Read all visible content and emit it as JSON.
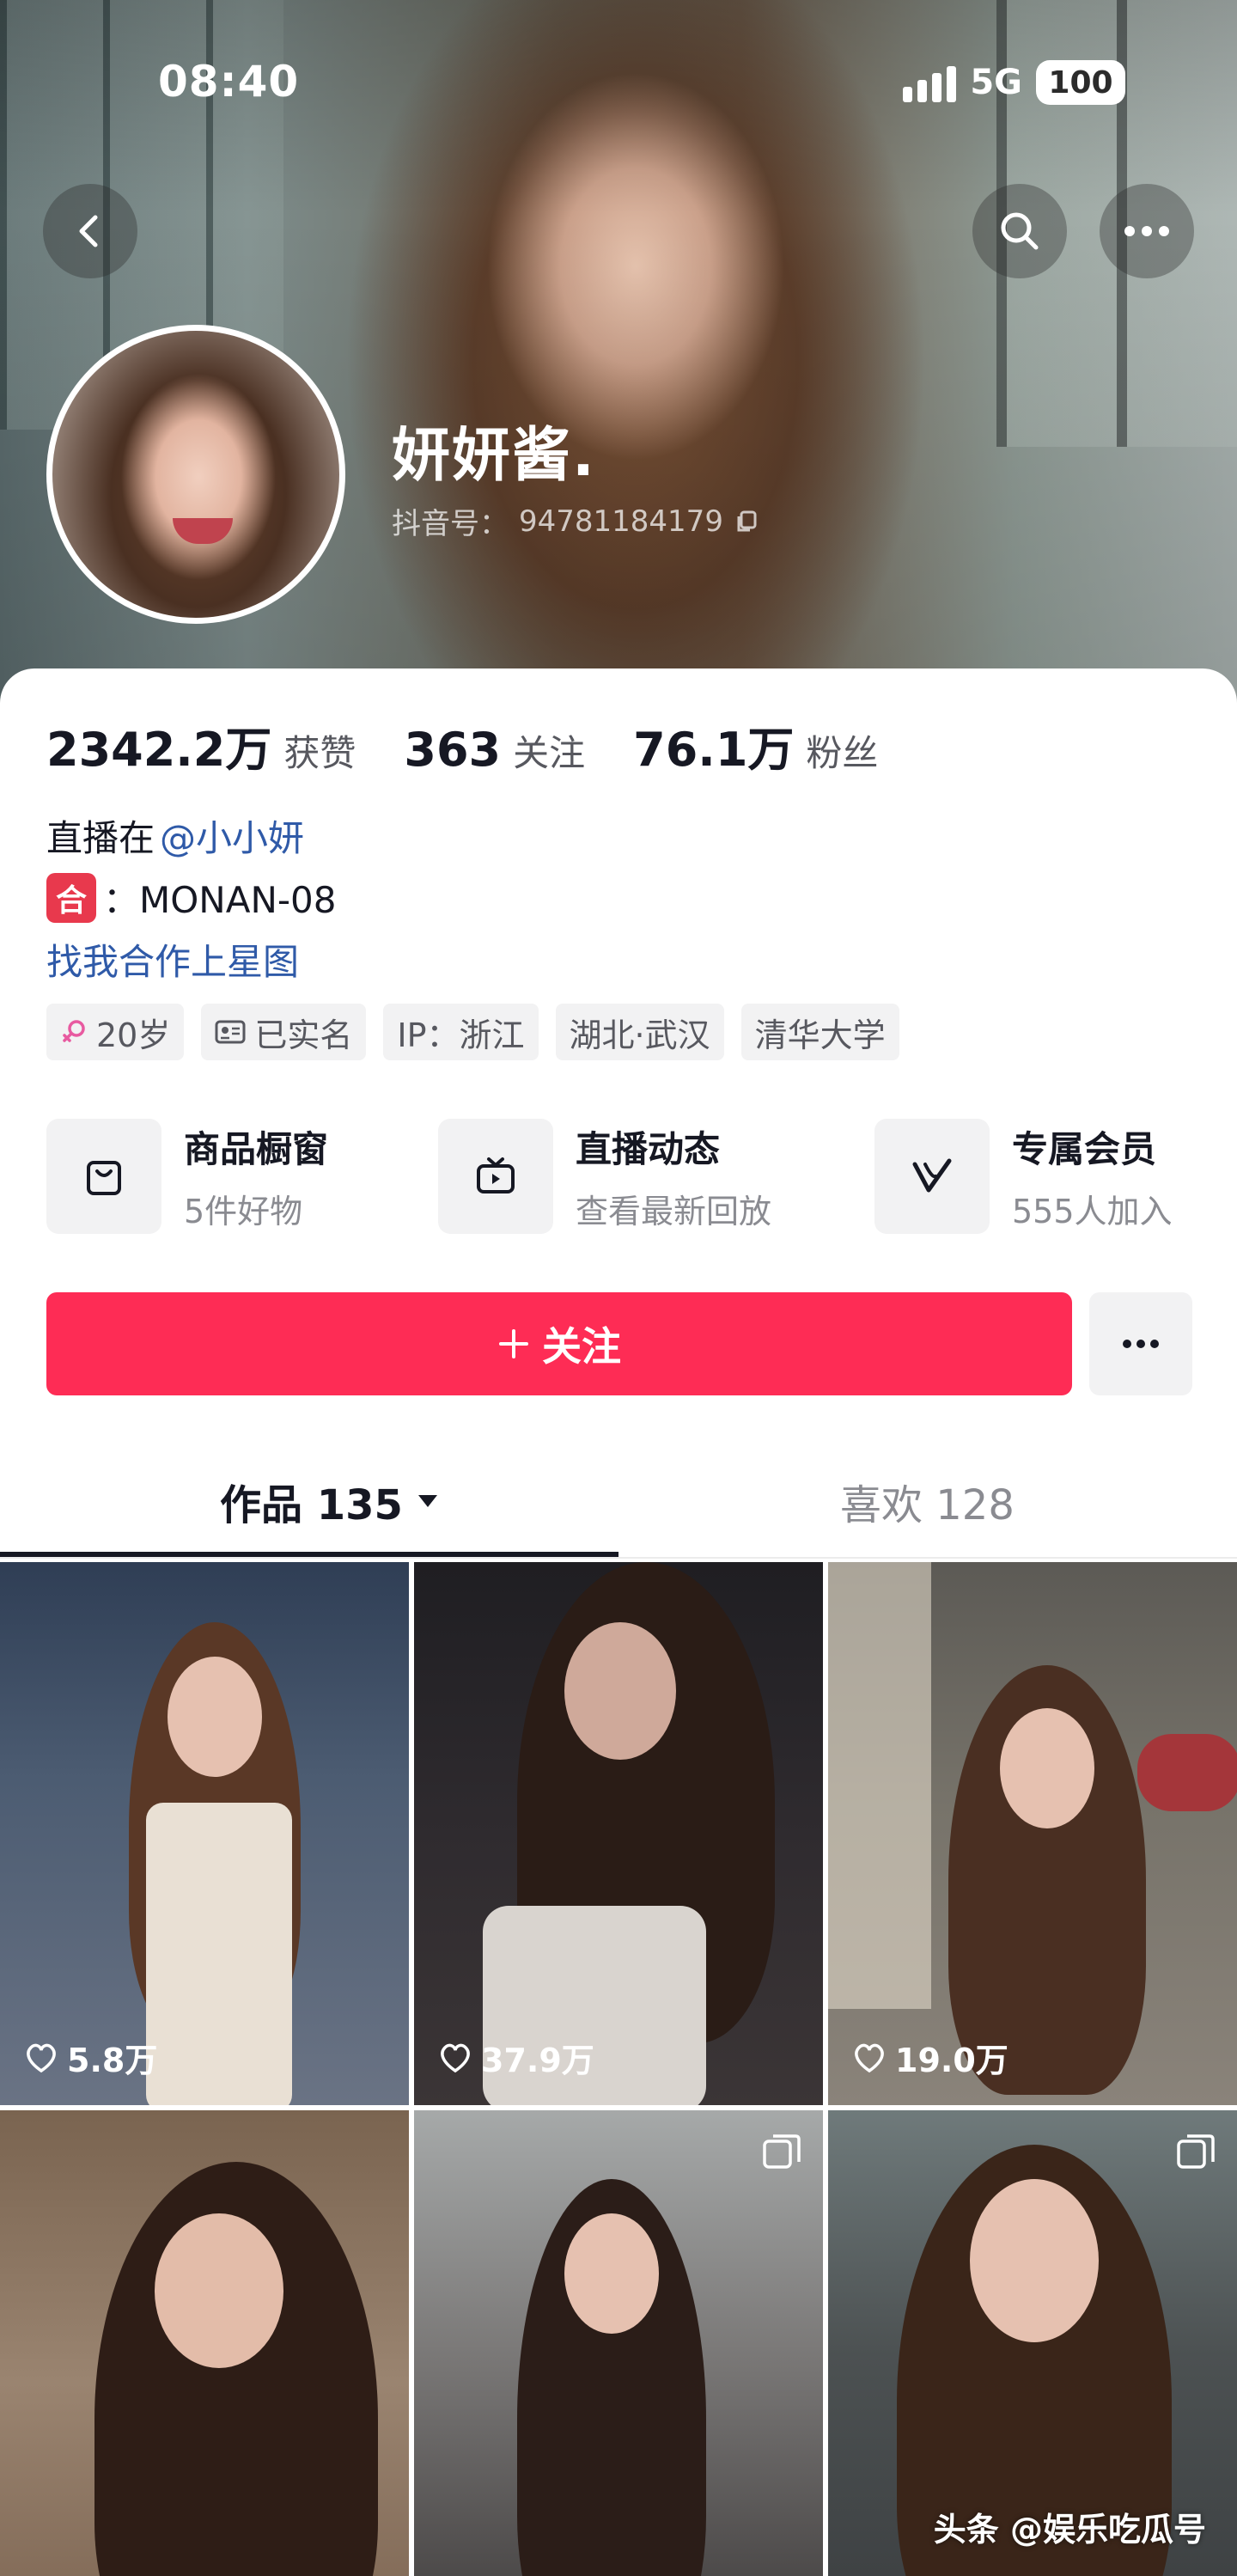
{
  "status_bar": {
    "time": "08:40",
    "network": "5G",
    "battery": "100"
  },
  "profile": {
    "name": "妍妍酱.",
    "douyin_id_label": "抖音号：",
    "douyin_id": "94781184179"
  },
  "stats": [
    {
      "value": "2342.2万",
      "label": "获赞"
    },
    {
      "value": "363",
      "label": "关注"
    },
    {
      "value": "76.1万",
      "label": "粉丝"
    }
  ],
  "bio": {
    "live_prefix": "直播在",
    "live_mention": "@小小妍",
    "coop_badge": "合",
    "coop_text": "：MONAN-08",
    "link": "找我合作上星图"
  },
  "tags": [
    {
      "icon": "female-icon",
      "text": "20岁"
    },
    {
      "icon": "id-card-icon",
      "text": "已实名"
    },
    {
      "icon": "",
      "text": "IP：浙江"
    },
    {
      "icon": "",
      "text": "湖北·武汉"
    },
    {
      "icon": "",
      "text": "清华大学"
    }
  ],
  "features": [
    {
      "icon": "shopping-bag-icon",
      "title": "商品橱窗",
      "subtitle": "5件好物"
    },
    {
      "icon": "live-tv-icon",
      "title": "直播动态",
      "subtitle": "查看最新回放"
    },
    {
      "icon": "vip-v-icon",
      "title": "专属会员",
      "subtitle": "555人加入"
    }
  ],
  "follow": {
    "label": "关注",
    "accent": "#fe2c55"
  },
  "tabs": [
    {
      "label": "作品 135"
    },
    {
      "label": "喜欢 128"
    }
  ],
  "videos": [
    {
      "likes": "5.8万"
    },
    {
      "likes": "37.9万"
    },
    {
      "likes": "19.0万"
    },
    {
      "likes": ""
    },
    {
      "likes": ""
    },
    {
      "likes": ""
    }
  ],
  "watermark": "头条 @娱乐吃瓜号"
}
